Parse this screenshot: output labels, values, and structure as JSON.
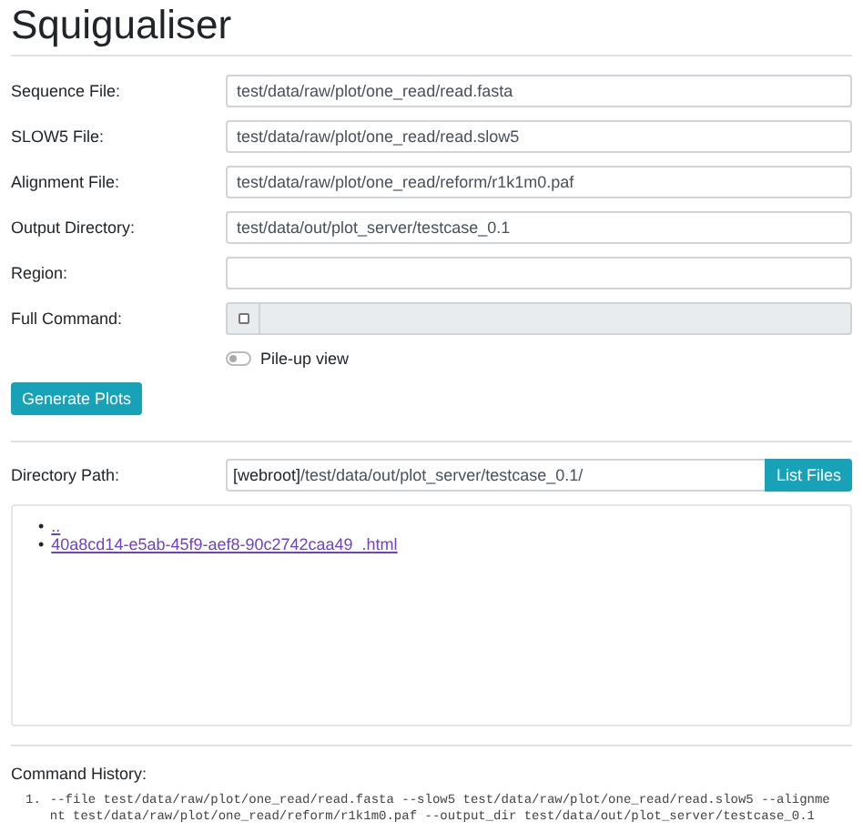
{
  "title": "Squigualiser",
  "fields": [
    {
      "kind": "text",
      "label": "Sequence File:",
      "value": "test/data/raw/plot/one_read/read.fasta"
    },
    {
      "kind": "text",
      "label": "SLOW5 File:",
      "value": "test/data/raw/plot/one_read/read.slow5"
    },
    {
      "kind": "text",
      "label": "Alignment File:",
      "value": "test/data/raw/plot/one_read/reform/r1k1m0.paf"
    },
    {
      "kind": "text",
      "label": "Output Directory:",
      "value": "test/data/out/plot_server/testcase_0.1"
    },
    {
      "kind": "text",
      "label": "Region:"
    },
    {
      "kind": "command",
      "label": "Full Command:",
      "checked": false
    }
  ],
  "pileup": {
    "label": "Pile-up view",
    "on": false
  },
  "generate_button": "Generate Plots",
  "directory": {
    "label": "Directory Path:",
    "prefix": "[webroot]",
    "value": "/test/data/out/plot_server/testcase_0.1/",
    "button": "List Files"
  },
  "files": [
    {
      "marker": "•",
      "name": ".."
    },
    {
      "marker": "•",
      "name": "40a8cd14-e5ab-45f9-aef8-90c2742caa49_.html"
    }
  ],
  "history": {
    "label": "Command History:",
    "commands": [
      {
        "number": "1.",
        "text": "--file test/data/raw/plot/one_read/read.fasta --slow5 test/data/raw/plot/one_read/read.slow5 --alignment test/data/raw/plot/one_read/reform/r1k1m0.paf --output_dir test/data/out/plot_server/testcase_0.1"
      }
    ]
  }
}
